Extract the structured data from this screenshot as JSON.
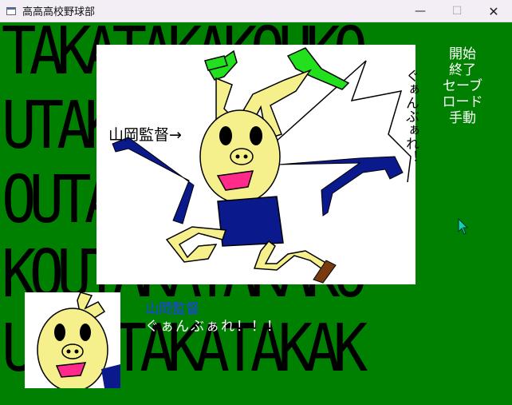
{
  "window": {
    "title": "高高高校野球部",
    "minimize_glyph": "—",
    "maximize_glyph": "☐",
    "close_glyph": "✕"
  },
  "background_text": [
    "TAKATAKAKOUKO",
    "UTAKATAKAKOUK",
    "OUTAKATAKAKOU",
    "KOUTAKATAKAKO",
    "UKOUTAKATAKAK"
  ],
  "scene": {
    "caption": "山岡監督→",
    "shout_vertical": "ぐぁんぶぁれ！"
  },
  "menu": {
    "items": [
      "開始",
      "終了",
      "セーブ",
      "ロード",
      "手動"
    ]
  },
  "dialogue": {
    "speaker": "山岡監督",
    "text": "ぐぁんぶぁれ！！！"
  },
  "colors": {
    "background": "#008000",
    "skin": "#f5f08c",
    "shirt": "#0a1a8c",
    "leaf": "#22e01e",
    "mouth": "#ff2a8a",
    "speaker": "#1e3cff",
    "dialogue": "#ffffff"
  },
  "icons": {
    "app": "window-app-icon",
    "cursor": "mouse-pointer-icon"
  }
}
